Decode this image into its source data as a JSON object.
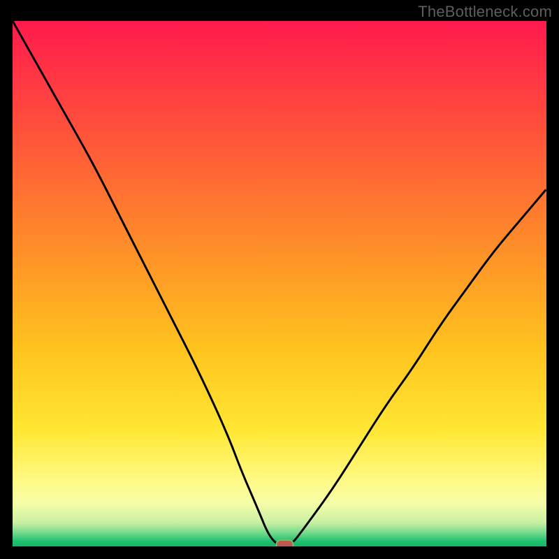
{
  "watermark": "TheBottleneck.com",
  "colors": {
    "black": "#000000",
    "curve": "#000000",
    "marker_fill": "#c1584f",
    "marker_stroke": "#6fbc6a",
    "gradient_stops": [
      {
        "offset": 0.0,
        "color": "#ff1a4e"
      },
      {
        "offset": 0.2,
        "color": "#ff4f3b"
      },
      {
        "offset": 0.42,
        "color": "#ff8b2a"
      },
      {
        "offset": 0.62,
        "color": "#ffc21e"
      },
      {
        "offset": 0.78,
        "color": "#ffe733"
      },
      {
        "offset": 0.88,
        "color": "#fffb8a"
      },
      {
        "offset": 0.92,
        "color": "#f4fca8"
      },
      {
        "offset": 0.955,
        "color": "#c7f0a2"
      },
      {
        "offset": 0.975,
        "color": "#6fd98b"
      },
      {
        "offset": 0.99,
        "color": "#1fc06f"
      },
      {
        "offset": 1.0,
        "color": "#17b668"
      }
    ]
  },
  "chart_data": {
    "type": "line",
    "title": "",
    "xlabel": "",
    "ylabel": "",
    "xlim": [
      0,
      100
    ],
    "ylim": [
      0,
      100
    ],
    "grid": false,
    "legend": false,
    "annotations": [],
    "series": [
      {
        "name": "bottleneck-curve",
        "x": [
          0,
          5,
          10,
          15,
          20,
          25,
          30,
          35,
          40,
          43,
          46,
          48,
          50,
          52,
          55,
          60,
          65,
          70,
          75,
          80,
          85,
          90,
          95,
          100
        ],
        "values": [
          100,
          91,
          82,
          73,
          63,
          53,
          43,
          33,
          22,
          14,
          7,
          2,
          0,
          0,
          4,
          11,
          19,
          27,
          34,
          42,
          49,
          56,
          62,
          68
        ]
      }
    ],
    "marker": {
      "x": 51,
      "y": 0
    }
  }
}
